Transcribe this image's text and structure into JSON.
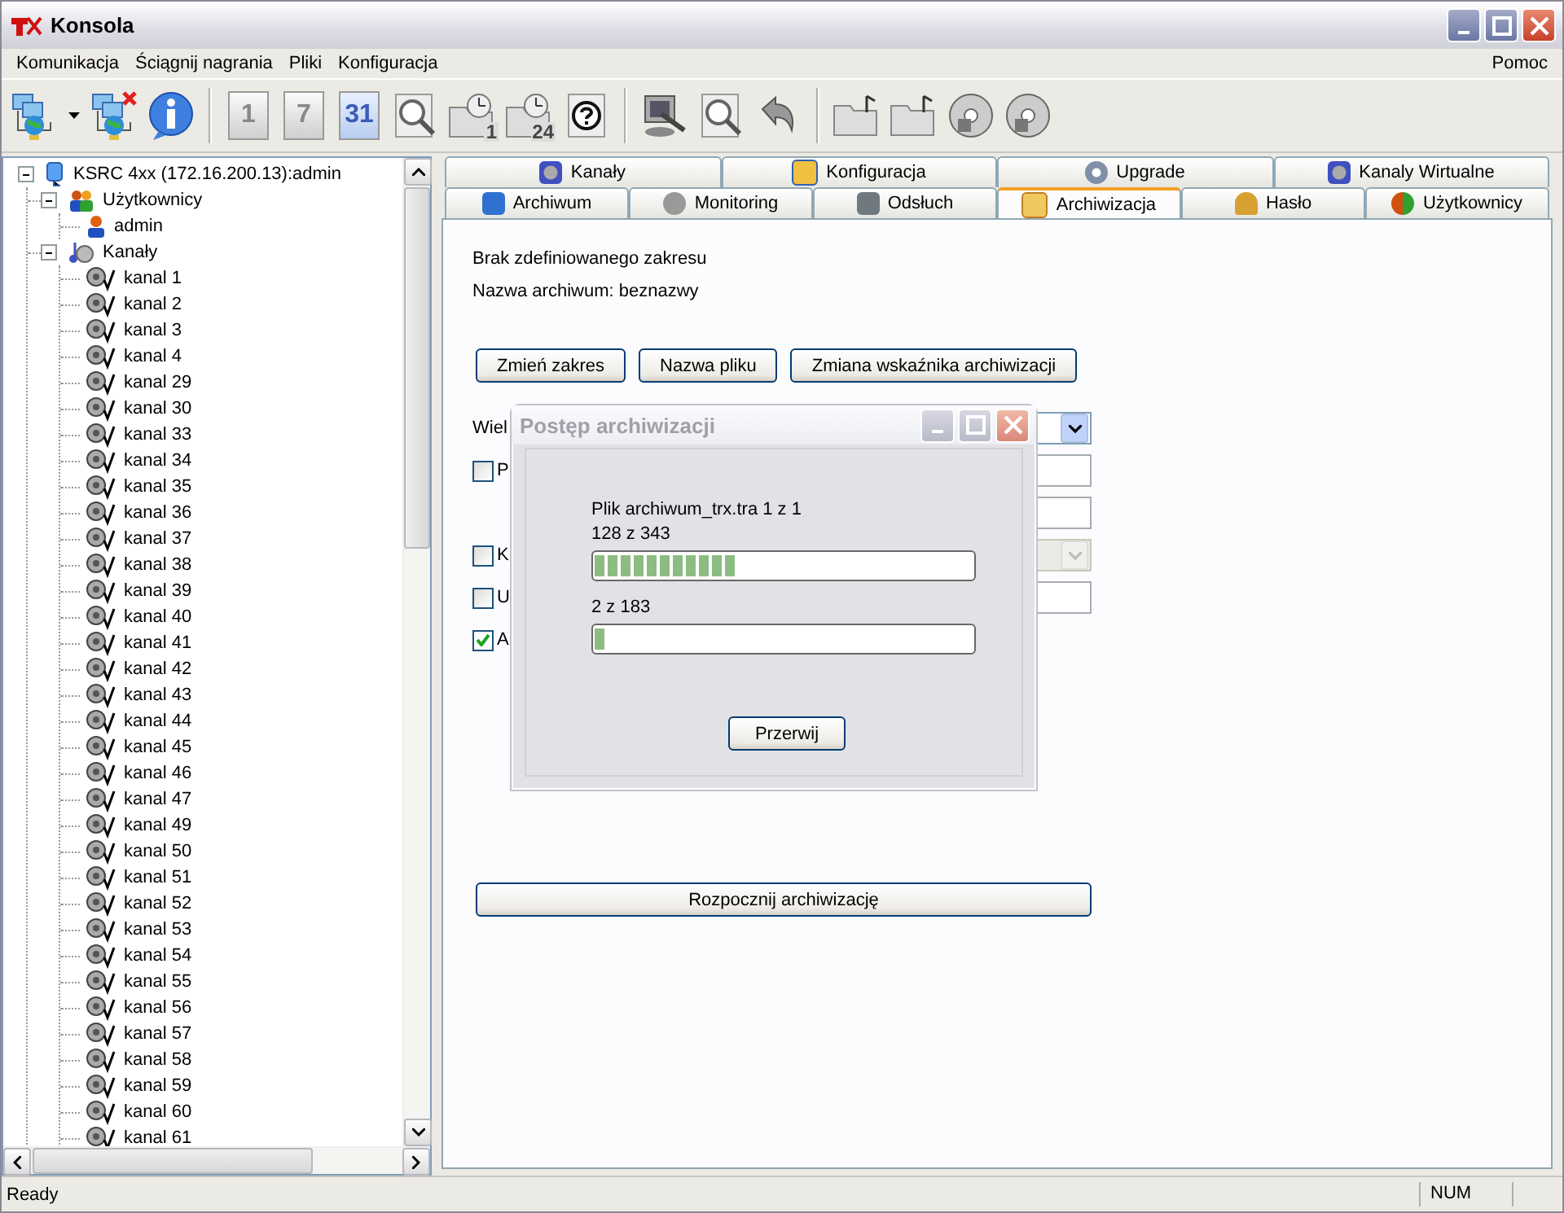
{
  "window": {
    "title": "Konsola"
  },
  "menu": {
    "items": [
      "Komunikacja",
      "Ściągnij nagrania",
      "Pliki",
      "Konfiguracja"
    ],
    "help": "Pomoc"
  },
  "toolbar": [
    {
      "kind": "connect"
    },
    {
      "kind": "dropdown"
    },
    {
      "kind": "disconnect"
    },
    {
      "kind": "info"
    },
    {
      "kind": "sep"
    },
    {
      "kind": "day",
      "label": "1",
      "selected": false
    },
    {
      "kind": "day",
      "label": "7",
      "selected": false
    },
    {
      "kind": "day",
      "label": "31",
      "selected": true
    },
    {
      "kind": "search"
    },
    {
      "kind": "clock",
      "label": "1"
    },
    {
      "kind": "clock",
      "label": "24"
    },
    {
      "kind": "help"
    },
    {
      "kind": "sep"
    },
    {
      "kind": "tool"
    },
    {
      "kind": "search"
    },
    {
      "kind": "undo"
    },
    {
      "kind": "sep"
    },
    {
      "kind": "folder"
    },
    {
      "kind": "folder"
    },
    {
      "kind": "disc"
    },
    {
      "kind": "disc"
    }
  ],
  "tree": {
    "label": "KSRC 4xx (172.16.200.13):admin",
    "expanded": true,
    "children": [
      {
        "label": "Użytkownicy",
        "kind": "users",
        "expanded": true,
        "children": [
          {
            "label": "admin",
            "kind": "user"
          }
        ]
      },
      {
        "label": "Kanały",
        "kind": "channels",
        "expanded": true,
        "children": [
          {
            "label": "kanal 1",
            "kind": "channel"
          },
          {
            "label": "kanal 2",
            "kind": "channel"
          },
          {
            "label": "kanal 3",
            "kind": "channel"
          },
          {
            "label": "kanal 4",
            "kind": "channel"
          },
          {
            "label": "kanal 29",
            "kind": "channel"
          },
          {
            "label": "kanal 30",
            "kind": "channel"
          },
          {
            "label": "kanal 33",
            "kind": "channel"
          },
          {
            "label": "kanal 34",
            "kind": "channel"
          },
          {
            "label": "kanal 35",
            "kind": "channel"
          },
          {
            "label": "kanal 36",
            "kind": "channel"
          },
          {
            "label": "kanal 37",
            "kind": "channel"
          },
          {
            "label": "kanal 38",
            "kind": "channel"
          },
          {
            "label": "kanal 39",
            "kind": "channel"
          },
          {
            "label": "kanal 40",
            "kind": "channel"
          },
          {
            "label": "kanal 41",
            "kind": "channel"
          },
          {
            "label": "kanal 42",
            "kind": "channel"
          },
          {
            "label": "kanal 43",
            "kind": "channel"
          },
          {
            "label": "kanal 44",
            "kind": "channel"
          },
          {
            "label": "kanal 45",
            "kind": "channel"
          },
          {
            "label": "kanal 46",
            "kind": "channel"
          },
          {
            "label": "kanal 47",
            "kind": "channel"
          },
          {
            "label": "kanal 49",
            "kind": "channel"
          },
          {
            "label": "kanal 50",
            "kind": "channel"
          },
          {
            "label": "kanal 51",
            "kind": "channel"
          },
          {
            "label": "kanal 52",
            "kind": "channel"
          },
          {
            "label": "kanal 53",
            "kind": "channel"
          },
          {
            "label": "kanal 54",
            "kind": "channel"
          },
          {
            "label": "kanal 55",
            "kind": "channel"
          },
          {
            "label": "kanal 56",
            "kind": "channel"
          },
          {
            "label": "kanal 57",
            "kind": "channel"
          },
          {
            "label": "kanal 58",
            "kind": "channel"
          },
          {
            "label": "kanal 59",
            "kind": "channel"
          },
          {
            "label": "kanal 60",
            "kind": "channel"
          },
          {
            "label": "kanal 61",
            "kind": "channel"
          }
        ]
      }
    ]
  },
  "tabs_top": [
    {
      "label": "Kanały",
      "kind": "channels",
      "selected": false
    },
    {
      "label": "Konfiguracja",
      "kind": "config",
      "selected": false
    },
    {
      "label": "Upgrade",
      "kind": "gear",
      "selected": false
    },
    {
      "label": "Kanaly Wirtualne",
      "kind": "channels",
      "selected": false
    }
  ],
  "tabs_bottom": [
    {
      "label": "Archiwum",
      "kind": "archive",
      "selected": false
    },
    {
      "label": "Monitoring",
      "kind": "speaker",
      "selected": false
    },
    {
      "label": "Odsłuch",
      "kind": "door",
      "selected": false
    },
    {
      "label": "Archiwizacja",
      "kind": "folder",
      "selected": true
    },
    {
      "label": "Hasło",
      "kind": "key",
      "selected": false
    },
    {
      "label": "Użytkownicy",
      "kind": "users",
      "selected": false
    }
  ],
  "archive": {
    "range_text": "Brak zdefiniowanego zakresu",
    "name_text": "Nazwa archiwum: beznazwy",
    "buttons": [
      "Zmień zakres",
      "Nazwa pliku",
      "Zmiana wskaźnika archiwizacji"
    ],
    "rows": [
      {
        "kind": "combo",
        "label": "Wiel",
        "disabled": false
      },
      {
        "kind": "check",
        "label": "P",
        "checked": false
      },
      {
        "kind": "field"
      },
      {
        "kind": "checkcombo",
        "label": "K",
        "checked": false,
        "disabled": true
      },
      {
        "kind": "check",
        "label": "U",
        "checked": false
      },
      {
        "kind": "checkonly",
        "label": "A",
        "checked": true
      }
    ],
    "start_button": "Rozpocznij archiwizację"
  },
  "dialog": {
    "title": "Postęp archiwizacji",
    "file_text": "Plik archiwum_trx.tra  1 z 1",
    "progress1_text": "128 z 343",
    "progress1": {
      "level": 0.373
    },
    "progress2_text": "2 z 183",
    "progress2": {
      "level": 0.02
    },
    "button": "Przerwij"
  },
  "status_bar": {
    "text": "Ready",
    "indicator": "NUM"
  }
}
